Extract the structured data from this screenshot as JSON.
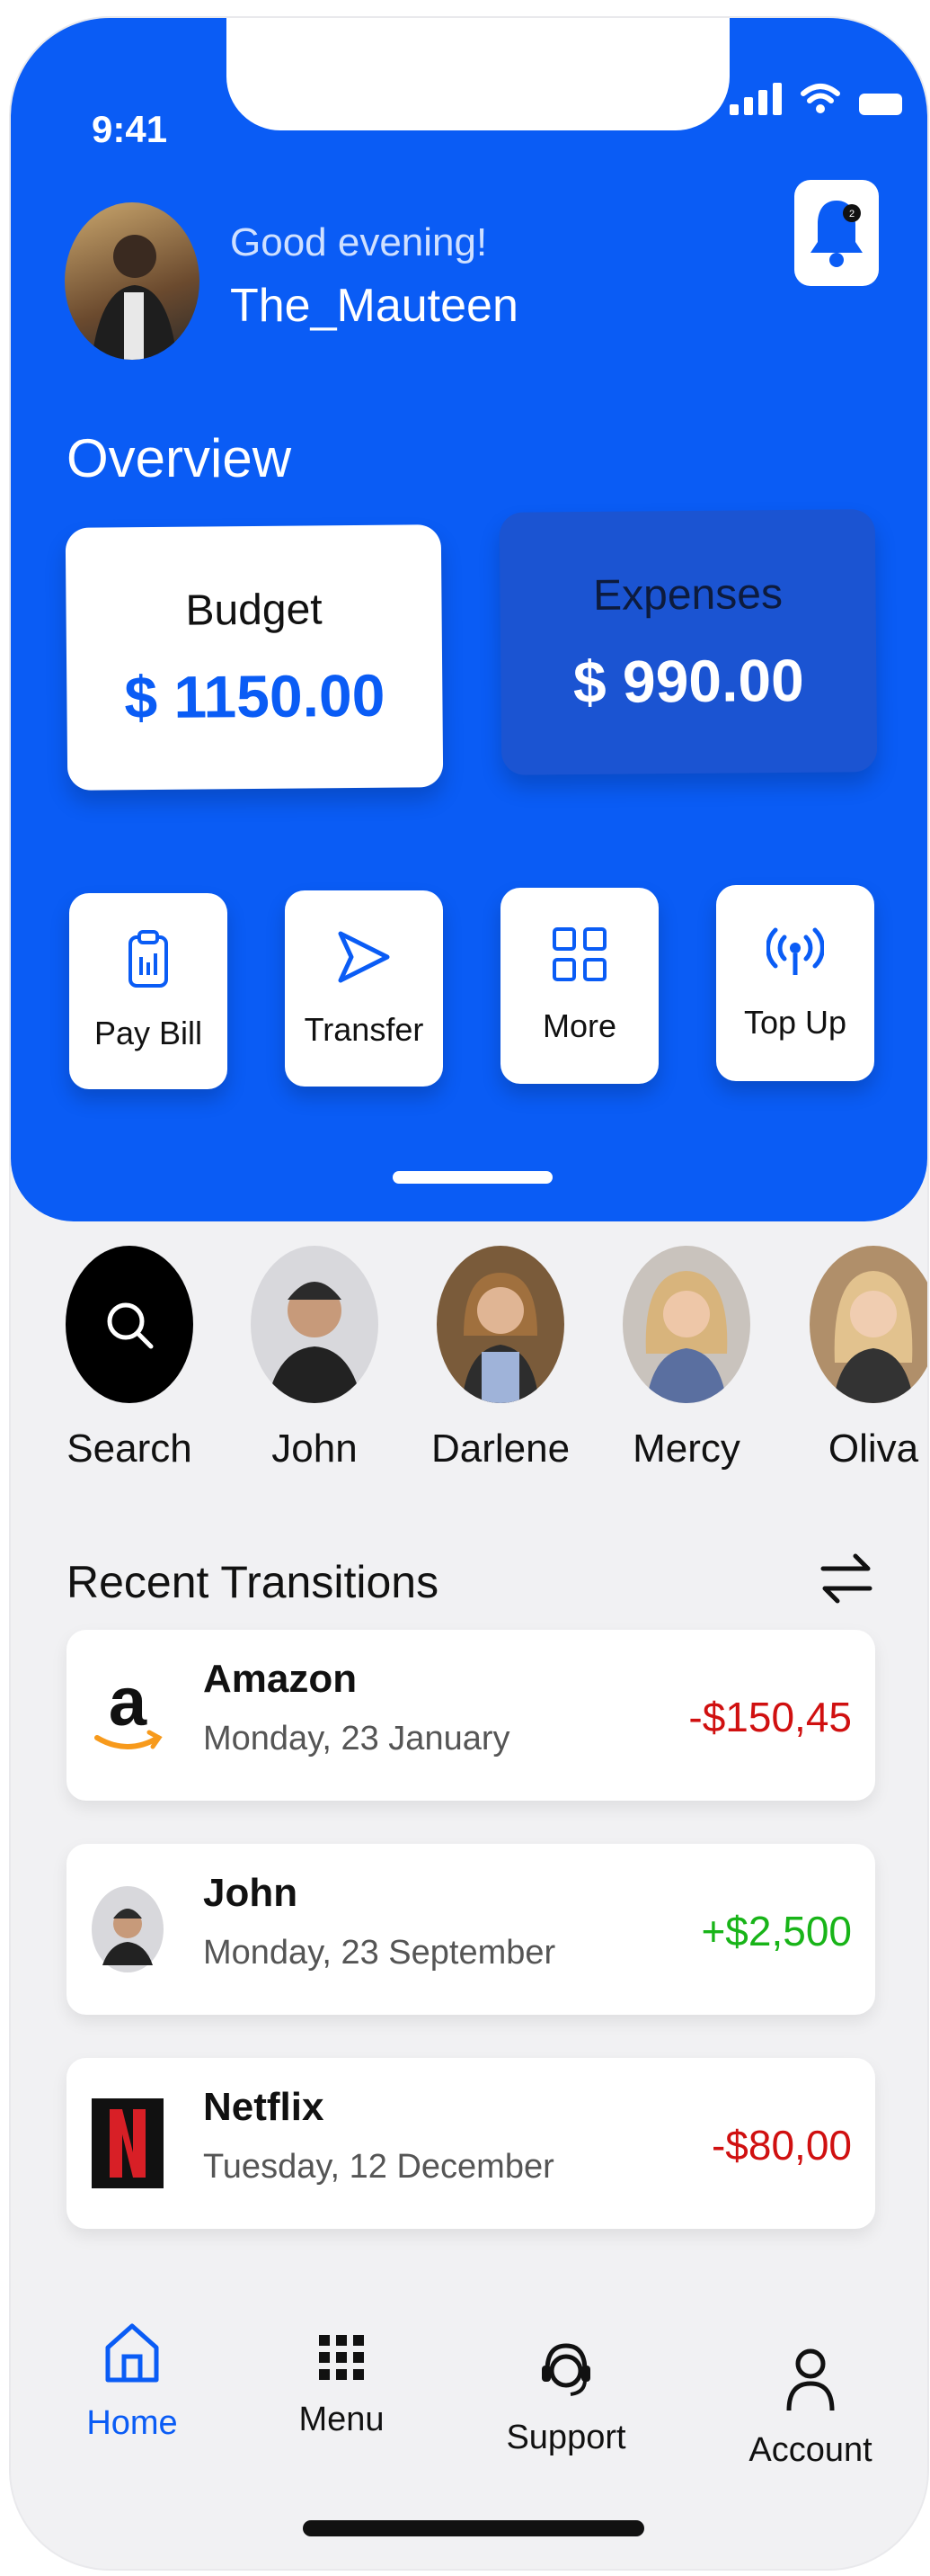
{
  "status_bar": {
    "time": "9:41"
  },
  "header": {
    "greeting": "Good evening!",
    "username": "The_Mauteen",
    "notification_count": "2"
  },
  "overview": {
    "title": "Overview",
    "budget": {
      "label": "Budget",
      "amount": "$ 1150.00"
    },
    "expenses": {
      "label": "Expenses",
      "amount": "$ 990.00"
    }
  },
  "quick_actions": [
    {
      "label": "Pay Bill",
      "icon": "clipboard-icon"
    },
    {
      "label": "Transfer",
      "icon": "send-icon"
    },
    {
      "label": "More",
      "icon": "grid-icon"
    },
    {
      "label": "Top Up",
      "icon": "broadcast-icon"
    }
  ],
  "contacts": [
    {
      "name": "Search"
    },
    {
      "name": "John"
    },
    {
      "name": "Darlene"
    },
    {
      "name": "Mercy"
    },
    {
      "name": "Oliva"
    }
  ],
  "recent": {
    "title": "Recent Transitions",
    "items": [
      {
        "name": "Amazon",
        "date": "Monday, 23 January",
        "amount": "-$150,45"
      },
      {
        "name": "John",
        "date": "Monday, 23 September",
        "amount": "+$2,500"
      },
      {
        "name": "Netflix",
        "date": "Tuesday, 12 December",
        "amount": "-$80,00"
      }
    ]
  },
  "bottom_nav": [
    {
      "label": "Home"
    },
    {
      "label": "Menu"
    },
    {
      "label": "Support"
    },
    {
      "label": "Account"
    }
  ],
  "colors": {
    "primary": "#0a5cf5",
    "expenses_card": "#1b54d2",
    "negative": "#d01010",
    "positive": "#18b418"
  }
}
